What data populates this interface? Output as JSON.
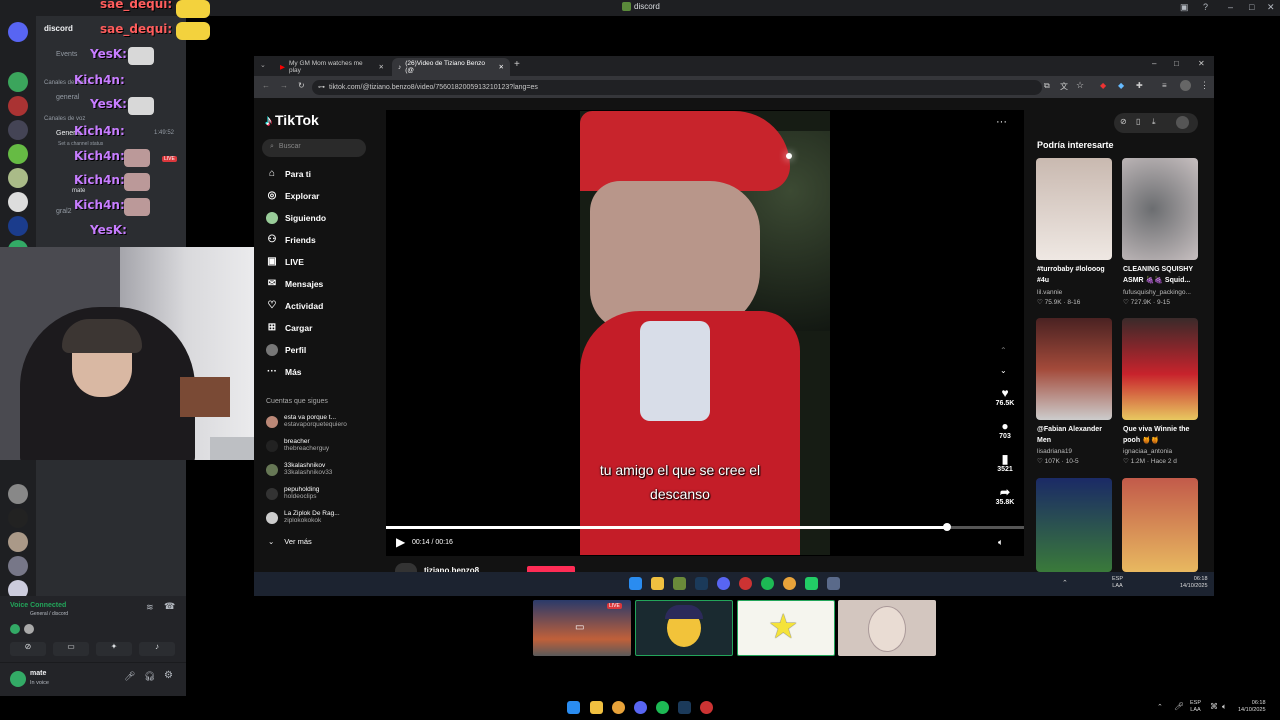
{
  "window": {
    "title": "discord"
  },
  "discord": {
    "header": "discord",
    "channels": {
      "events": "Events",
      "category_text": "Canales de texto",
      "text_general": "general",
      "category_voice": "Canales de voz",
      "voice_general": "General",
      "voice_timer": "1:49:52",
      "voice_status": "Set a channel status",
      "member_mate": "mate",
      "voice_gral2": "gral2",
      "live_badge": "LIVE"
    },
    "overlay_chat": {
      "user1": "sae_dequi:",
      "user2": "YesK:",
      "user3": "Kich4n:"
    },
    "voice_panel": {
      "status": "Voice Connected",
      "channel": "General / discord"
    },
    "user_panel": {
      "name": "mate",
      "status": "In voice"
    }
  },
  "browser": {
    "tabs": [
      {
        "label": "My GM Mom watches me play"
      },
      {
        "label": "(26)Video de Tiziano Benzo (@"
      }
    ],
    "url": "tiktok.com/@tiziano.benzo8/video/7560182005913210123?lang=es"
  },
  "tiktok": {
    "logo": "TikTok",
    "search_placeholder": "Buscar",
    "nav": [
      {
        "label": "Para ti",
        "icon": "home-icon"
      },
      {
        "label": "Explorar",
        "icon": "compass-icon"
      },
      {
        "label": "Siguiendo",
        "icon": "following-icon"
      },
      {
        "label": "Friends",
        "icon": "friends-icon"
      },
      {
        "label": "LIVE",
        "icon": "live-icon"
      },
      {
        "label": "Mensajes",
        "icon": "messages-icon"
      },
      {
        "label": "Actividad",
        "icon": "activity-icon"
      },
      {
        "label": "Cargar",
        "icon": "upload-icon"
      },
      {
        "label": "Perfil",
        "icon": "profile-icon"
      },
      {
        "label": "Más",
        "icon": "more-icon"
      }
    ],
    "following_header": "Cuentas que sigues",
    "accounts": [
      {
        "name": "esta va porque t...",
        "handle": "estavaporquetequiero"
      },
      {
        "name": "breacher",
        "handle": "thebreacherguy"
      },
      {
        "name": "33kalashnikov",
        "handle": "33kalashnikov33"
      },
      {
        "name": "pepuholding",
        "handle": "holdeoclips"
      },
      {
        "name": "La Ziplok De Rag...",
        "handle": "ziplokokokok"
      }
    ],
    "see_more": "Ver más",
    "video": {
      "caption_line1": "tu amigo el que se cree el",
      "caption_line2": "descanso",
      "time": "00:14 / 00:16",
      "progress": 0.88,
      "author": "tiziano.benzo8"
    },
    "actions": {
      "likes": "76.5K",
      "comments": "703",
      "saves": "3521",
      "shares": "35.8K"
    },
    "recs_title": "Podría interesarte",
    "recs": [
      {
        "title": "#turrobaby #lolooog #4u",
        "author": "lil.vannie",
        "meta": "♡ 75.9K · 8-16"
      },
      {
        "title": "CLEANING SQUISHY ASMR 🍇🍇 Squid...",
        "author": "fufusquishy_packingo...",
        "meta": "♡ 727.9K · 9-15"
      },
      {
        "title": "@Fabian Alexander Men",
        "author": "lisadriana19",
        "meta": "♡ 107K · 10-5"
      },
      {
        "title": "Que viva Winnie the pooh 🍯🍯",
        "author": "ignaciaa_antonia",
        "meta": "♡ 1.2M · Hace 2 d"
      }
    ]
  },
  "inner_taskbar": {
    "lang": "ESP",
    "lang2": "LAA",
    "time": "06:18",
    "date": "14/10/2025"
  },
  "stream_thumbs": {
    "live_badge": "LIVE"
  },
  "taskbar": {
    "lang": "ESP",
    "lang2": "LAA",
    "time": "06:18",
    "date": "14/10/2025"
  },
  "colors": {
    "tiktok_red": "#fe2c55",
    "discord_green": "#23a55a",
    "overlay_purple": "#c77dff"
  }
}
